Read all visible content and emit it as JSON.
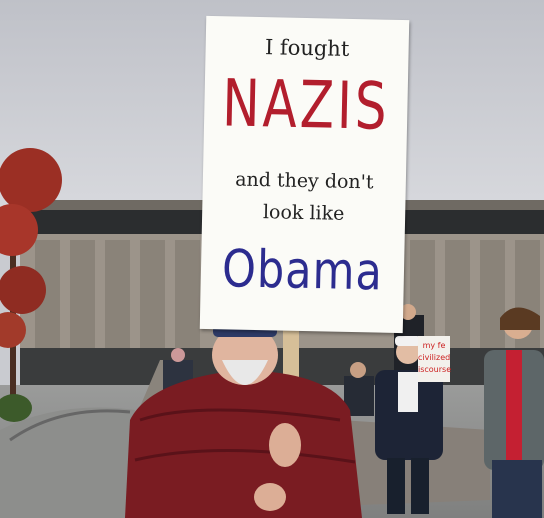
{
  "scene": {
    "description_alt": "Protest photo"
  },
  "sign": {
    "line1": "I fought",
    "line2": "NAZIS",
    "line3": "and they don't",
    "line4": "look like",
    "line5": "Obama"
  },
  "background_sign": {
    "line1": "my fe",
    "line2": "civilized",
    "line3": "iscourse"
  },
  "colors": {
    "sky": "#d7d8dc",
    "building": "#9a9288",
    "sign_red": "#b21e2d",
    "sign_blue": "#2c2c8f",
    "jacket": "#7a1c22"
  }
}
